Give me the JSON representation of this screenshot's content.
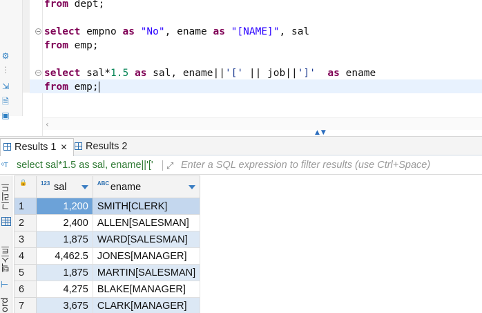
{
  "editor": {
    "lines": [
      {
        "id": "l1",
        "segments": [
          {
            "t": "from",
            "c": "kw"
          },
          {
            "t": " dept;",
            "c": ""
          }
        ]
      },
      {
        "id": "l2",
        "segments": [
          {
            "t": "select",
            "c": "kw"
          },
          {
            "t": " empno ",
            "c": ""
          },
          {
            "t": "as",
            "c": "kw"
          },
          {
            "t": " ",
            "c": ""
          },
          {
            "t": "\"No\"",
            "c": "str"
          },
          {
            "t": ", ename ",
            "c": ""
          },
          {
            "t": "as",
            "c": "kw"
          },
          {
            "t": " ",
            "c": ""
          },
          {
            "t": "\"[NAME]\"",
            "c": "str"
          },
          {
            "t": ", sal",
            "c": ""
          }
        ]
      },
      {
        "id": "l3",
        "segments": [
          {
            "t": "from",
            "c": "kw"
          },
          {
            "t": " emp;",
            "c": ""
          }
        ]
      },
      {
        "id": "l4",
        "segments": [
          {
            "t": "select",
            "c": "kw"
          },
          {
            "t": " sal*",
            "c": ""
          },
          {
            "t": "1.5",
            "c": "num"
          },
          {
            "t": " ",
            "c": ""
          },
          {
            "t": "as",
            "c": "kw"
          },
          {
            "t": " sal, ename||",
            "c": ""
          },
          {
            "t": "'['",
            "c": "str2"
          },
          {
            "t": " || job||",
            "c": ""
          },
          {
            "t": "']'",
            "c": "str2"
          },
          {
            "t": "  ",
            "c": ""
          },
          {
            "t": "as",
            "c": "kw"
          },
          {
            "t": " ename",
            "c": ""
          }
        ]
      },
      {
        "id": "l5",
        "segments": [
          {
            "t": "from",
            "c": "kw"
          },
          {
            "t": " emp;",
            "c": ""
          }
        ]
      }
    ]
  },
  "results": {
    "tabs": [
      {
        "label": "Results 1",
        "active": true,
        "closable": true
      },
      {
        "label": "Results 2",
        "active": false,
        "closable": false
      }
    ],
    "filter": {
      "query_text": "select sal*1.5 as sal, ename||'['",
      "placeholder": "Enter a SQL expression to filter results (use Ctrl+Space)"
    },
    "side_tabs": [
      "그리드",
      "텍스트",
      "ord"
    ],
    "columns": [
      {
        "name": "sal",
        "type_badge": "123"
      },
      {
        "name": "ename",
        "type_badge": "ABC"
      }
    ],
    "rows": [
      {
        "num": "1",
        "sal": "1,200",
        "ename": "SMITH[CLERK]"
      },
      {
        "num": "2",
        "sal": "2,400",
        "ename": "ALLEN[SALESMAN]"
      },
      {
        "num": "3",
        "sal": "1,875",
        "ename": "WARD[SALESMAN]"
      },
      {
        "num": "4",
        "sal": "4,462.5",
        "ename": "JONES[MANAGER]"
      },
      {
        "num": "5",
        "sal": "1,875",
        "ename": "MARTIN[SALESMAN]"
      },
      {
        "num": "6",
        "sal": "4,275",
        "ename": "BLAKE[MANAGER]"
      },
      {
        "num": "7",
        "sal": "3,675",
        "ename": "CLARK[MANAGER]"
      }
    ]
  }
}
